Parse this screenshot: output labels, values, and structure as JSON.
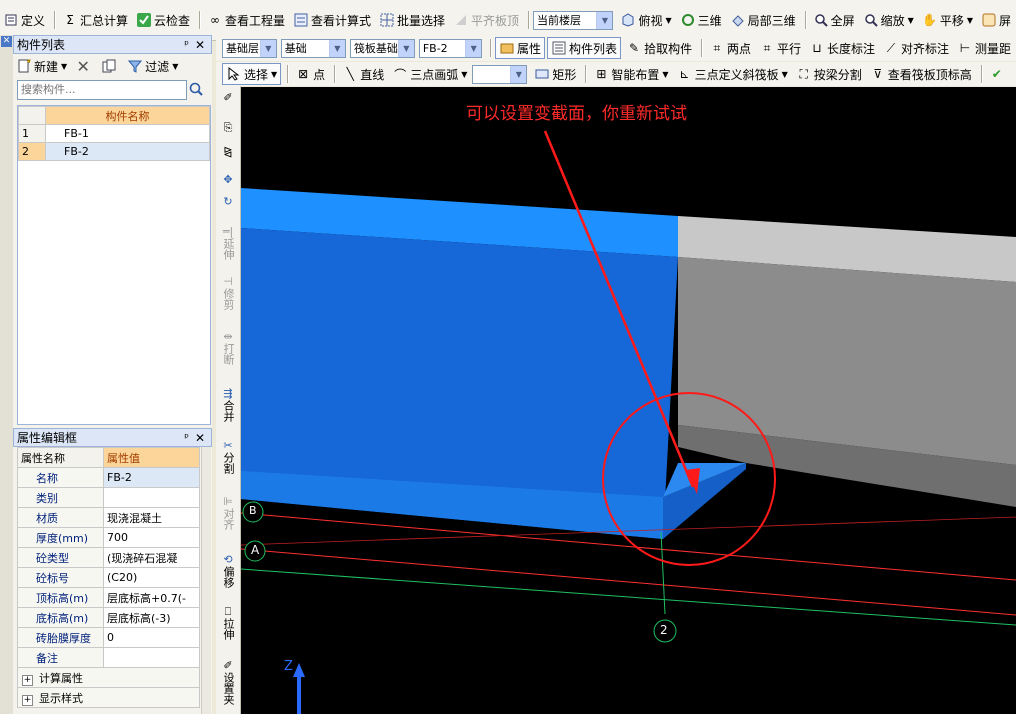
{
  "toolbar_main": {
    "define": "定义",
    "sum_calc": "汇总计算",
    "cloud_check": "云检查",
    "view_qty": "查看工程量",
    "view_formula": "查看计算式",
    "batch_select": "批量选择",
    "align_slab_top": "平齐板顶",
    "current_floor": "当前楼层",
    "top_view": "俯视",
    "three_d": "三维",
    "local_3d": "局部三维",
    "fullscreen": "全屏",
    "zoom": "缩放",
    "pan": "平移",
    "screen_rotate": "屏"
  },
  "toolbar_layer": {
    "floor": "基础层",
    "category": "基础",
    "type": "筏板基础",
    "component": "FB-2",
    "properties": "属性",
    "component_list": "构件列表",
    "pick_component": "拾取构件",
    "two_points": "两点",
    "parallel": "平行",
    "length_dim": "长度标注",
    "align_dim": "对齐标注",
    "measure_dist": "测量距"
  },
  "toolbar_draw": {
    "select": "选择",
    "point": "点",
    "line": "直线",
    "arc3": "三点画弧",
    "rect": "矩形",
    "smart_place": "智能布置",
    "three_point_slope": "三点定义斜筏板",
    "split_by_beam": "按梁分割",
    "view_slab_top_elev": "查看筏板顶标高"
  },
  "component_list": {
    "title": "构件列表",
    "new_label": "新建",
    "filter_label": "过滤",
    "search_placeholder": "搜索构件...",
    "column_header": "构件名称",
    "rows": [
      {
        "index": "1",
        "name": "FB-1"
      },
      {
        "index": "2",
        "name": "FB-2"
      }
    ]
  },
  "property_editor": {
    "title": "属性编辑框",
    "header_name": "属性名称",
    "header_value": "属性值",
    "rows": [
      {
        "name": "名称",
        "value": "FB-2"
      },
      {
        "name": "类别",
        "value": ""
      },
      {
        "name": "材质",
        "value": "现浇混凝土"
      },
      {
        "name": "厚度(mm)",
        "value": "700"
      },
      {
        "name": "砼类型",
        "value": "(现浇碎石混凝"
      },
      {
        "name": "砼标号",
        "value": "(C20)"
      },
      {
        "name": "顶标高(m)",
        "value": "层底标高+0.7(-"
      },
      {
        "name": "底标高(m)",
        "value": "层底标高(-3)"
      },
      {
        "name": "砖胎膜厚度",
        "value": "0"
      },
      {
        "name": "备注",
        "value": ""
      }
    ],
    "groups": [
      "计算属性",
      "显示样式"
    ]
  },
  "vertical_tools": {
    "extend": "延伸",
    "trim": "修剪",
    "break": "打断",
    "merge": "合并",
    "split": "分割",
    "align": "对齐",
    "offset": "偏移",
    "stretch": "拉伸",
    "set_slope": "设置夹"
  },
  "viewport": {
    "annotation": "可以设置变截面，你重新试试",
    "axis_a": "A",
    "axis_b": "B",
    "axis_2": "2",
    "axis_z": "Z"
  },
  "colors": {
    "annotation_red": "#ff2a2a",
    "slab_blue": "#1a7de8",
    "slab_gray": "#b4b4b4",
    "axis_green": "#20c060"
  }
}
